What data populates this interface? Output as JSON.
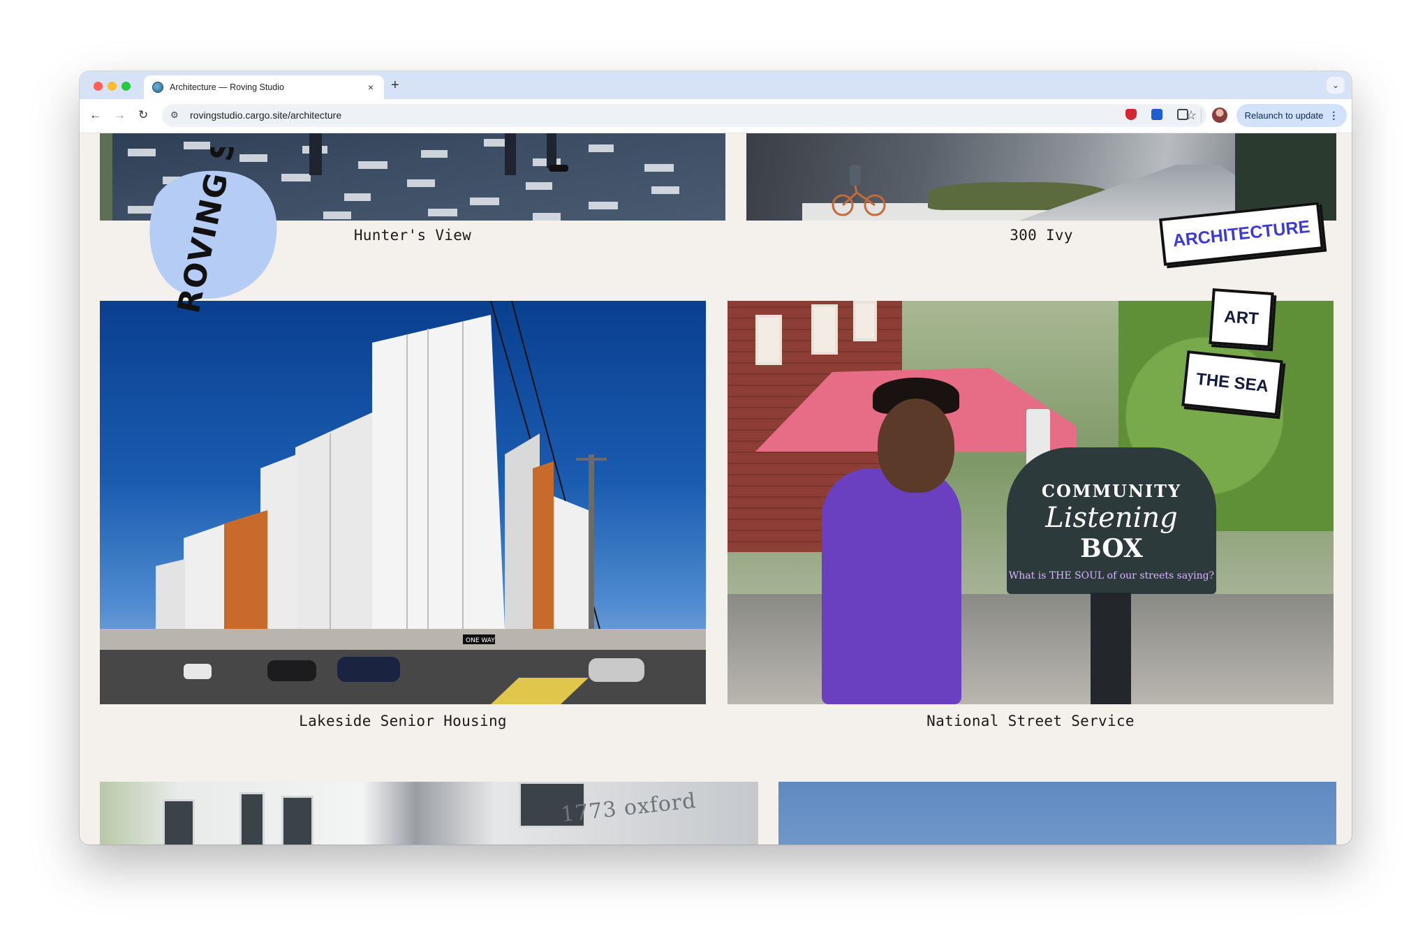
{
  "browser": {
    "tab_title": "Architecture — Roving Studio",
    "tab_close": "×",
    "new_tab": "+",
    "url": "rovingstudio.cargo.site/architecture",
    "relaunch_label": "Relaunch to update",
    "relaunch_menu": "⋮",
    "nav_back": "←",
    "nav_forward": "→",
    "nav_reload": "↻",
    "star": "☆",
    "site_info": "⚙",
    "tab_dropdown": "⌄"
  },
  "site": {
    "logo_text": "ROVING STUDIO",
    "logo_color": "#b5cdf5",
    "nav": [
      {
        "label": "ARCHITECTURE",
        "active": true,
        "color": "#3d3ad6"
      },
      {
        "label": "ART"
      },
      {
        "label": "THE SEA"
      }
    ]
  },
  "projects": [
    {
      "title": "Hunter's View"
    },
    {
      "title": "300 Ivy"
    },
    {
      "title": "Lakeside Senior Housing"
    },
    {
      "title": "National Street Service"
    },
    {
      "title": "1773 oxford"
    }
  ],
  "photo_text": {
    "mailbox_line1": "COMMUNITY",
    "mailbox_line2": "Listening",
    "mailbox_line3": "BOX",
    "mailbox_line4": "What is THE SOUL of our streets saying?",
    "one_way": "ONE WAY"
  },
  "colors": {
    "page_bg": "#f4f1ec",
    "tabbar_bg": "#d6e3f7",
    "accent": "#3d3ad6"
  }
}
